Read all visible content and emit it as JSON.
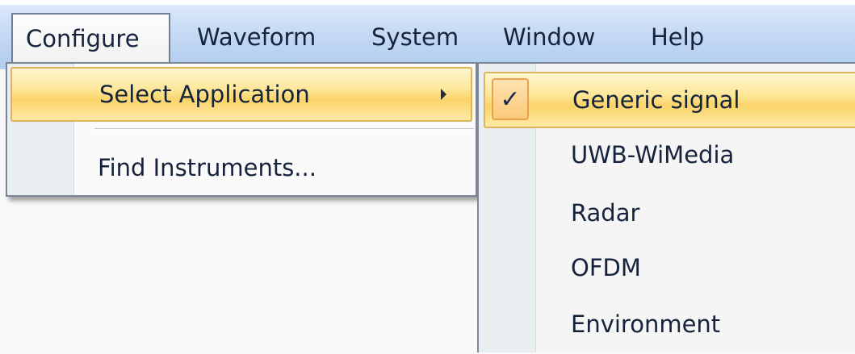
{
  "menubar": {
    "items": [
      {
        "label": "Configure"
      },
      {
        "label": "Waveform"
      },
      {
        "label": "System"
      },
      {
        "label": "Window"
      },
      {
        "label": "Help"
      }
    ]
  },
  "configure_menu": {
    "items": [
      {
        "label": "Select Application"
      },
      {
        "label": "Find Instruments..."
      }
    ]
  },
  "application_submenu": {
    "check_glyph": "✓",
    "items": [
      {
        "label": "Generic signal",
        "checked": true
      },
      {
        "label": "UWB-WiMedia"
      },
      {
        "label": "Radar"
      },
      {
        "label": "OFDM"
      },
      {
        "label": "Environment"
      }
    ]
  },
  "colors": {
    "menubar_blue": "#c3d8f3",
    "highlight_gold": "#fbd46a",
    "check_orange": "#e8a14f"
  }
}
